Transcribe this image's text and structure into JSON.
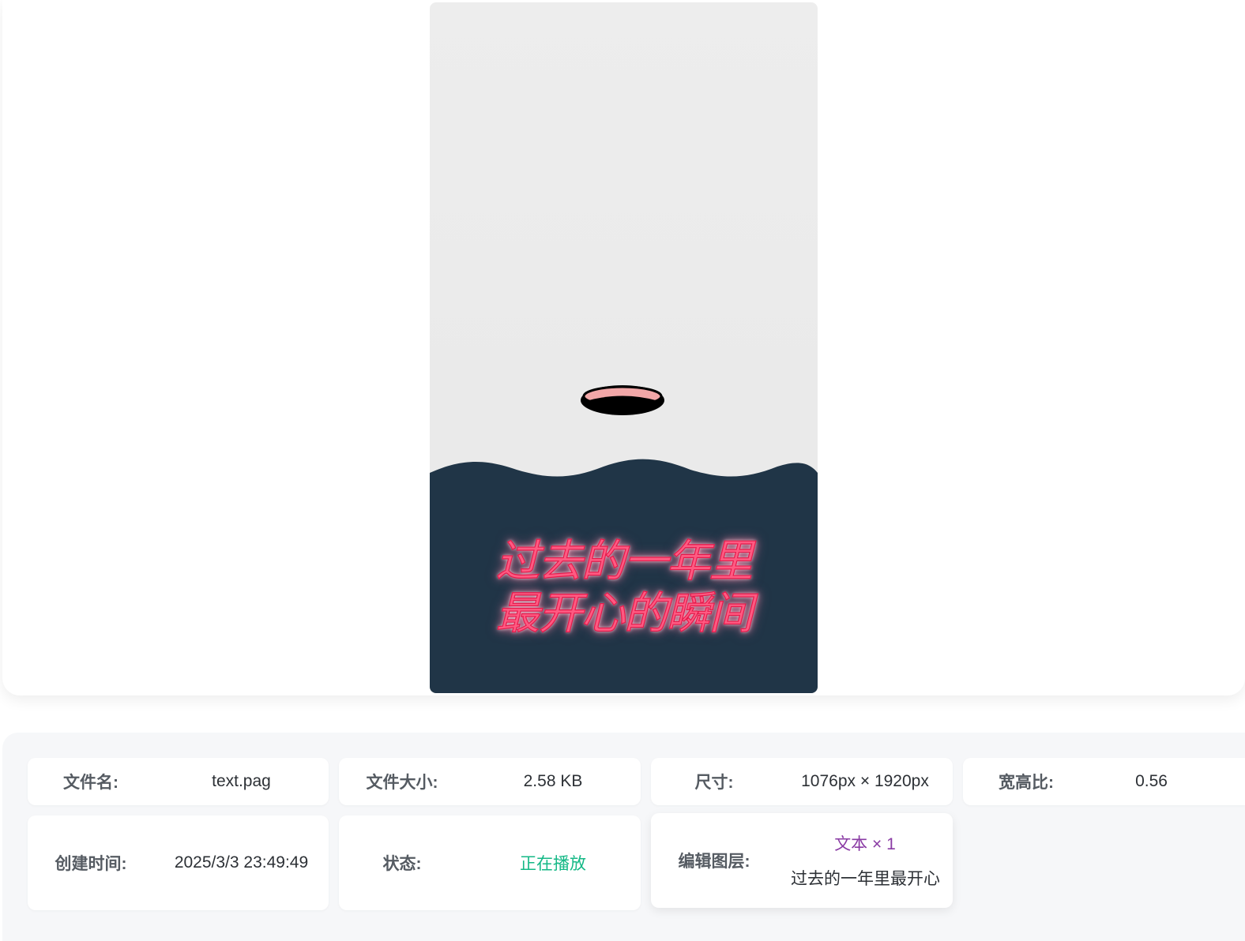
{
  "preview": {
    "headline_line1": "过去的一年里",
    "headline_line2": "最开心的瞬间",
    "colors": {
      "background": "#ebebeb",
      "wave": "#203547",
      "headline": "#ff5a82",
      "hole_rim": "#f2a7a8"
    }
  },
  "info": {
    "filename_label": "文件名:",
    "filename_value": "text.pag",
    "filesize_label": "文件大小:",
    "filesize_value": "2.58 KB",
    "dimensions_label": "尺寸:",
    "dimensions_value": "1076px × 1920px",
    "ratio_label": "宽高比:",
    "ratio_value": "0.56",
    "created_label": "创建时间:",
    "created_value": "2025/3/3 23:49:49",
    "status_label": "状态:",
    "status_value": "正在播放",
    "layers_label": "编辑图层:",
    "layers_count": "文本 × 1",
    "layers_text": "过去的一年里最开心的瞬间"
  }
}
